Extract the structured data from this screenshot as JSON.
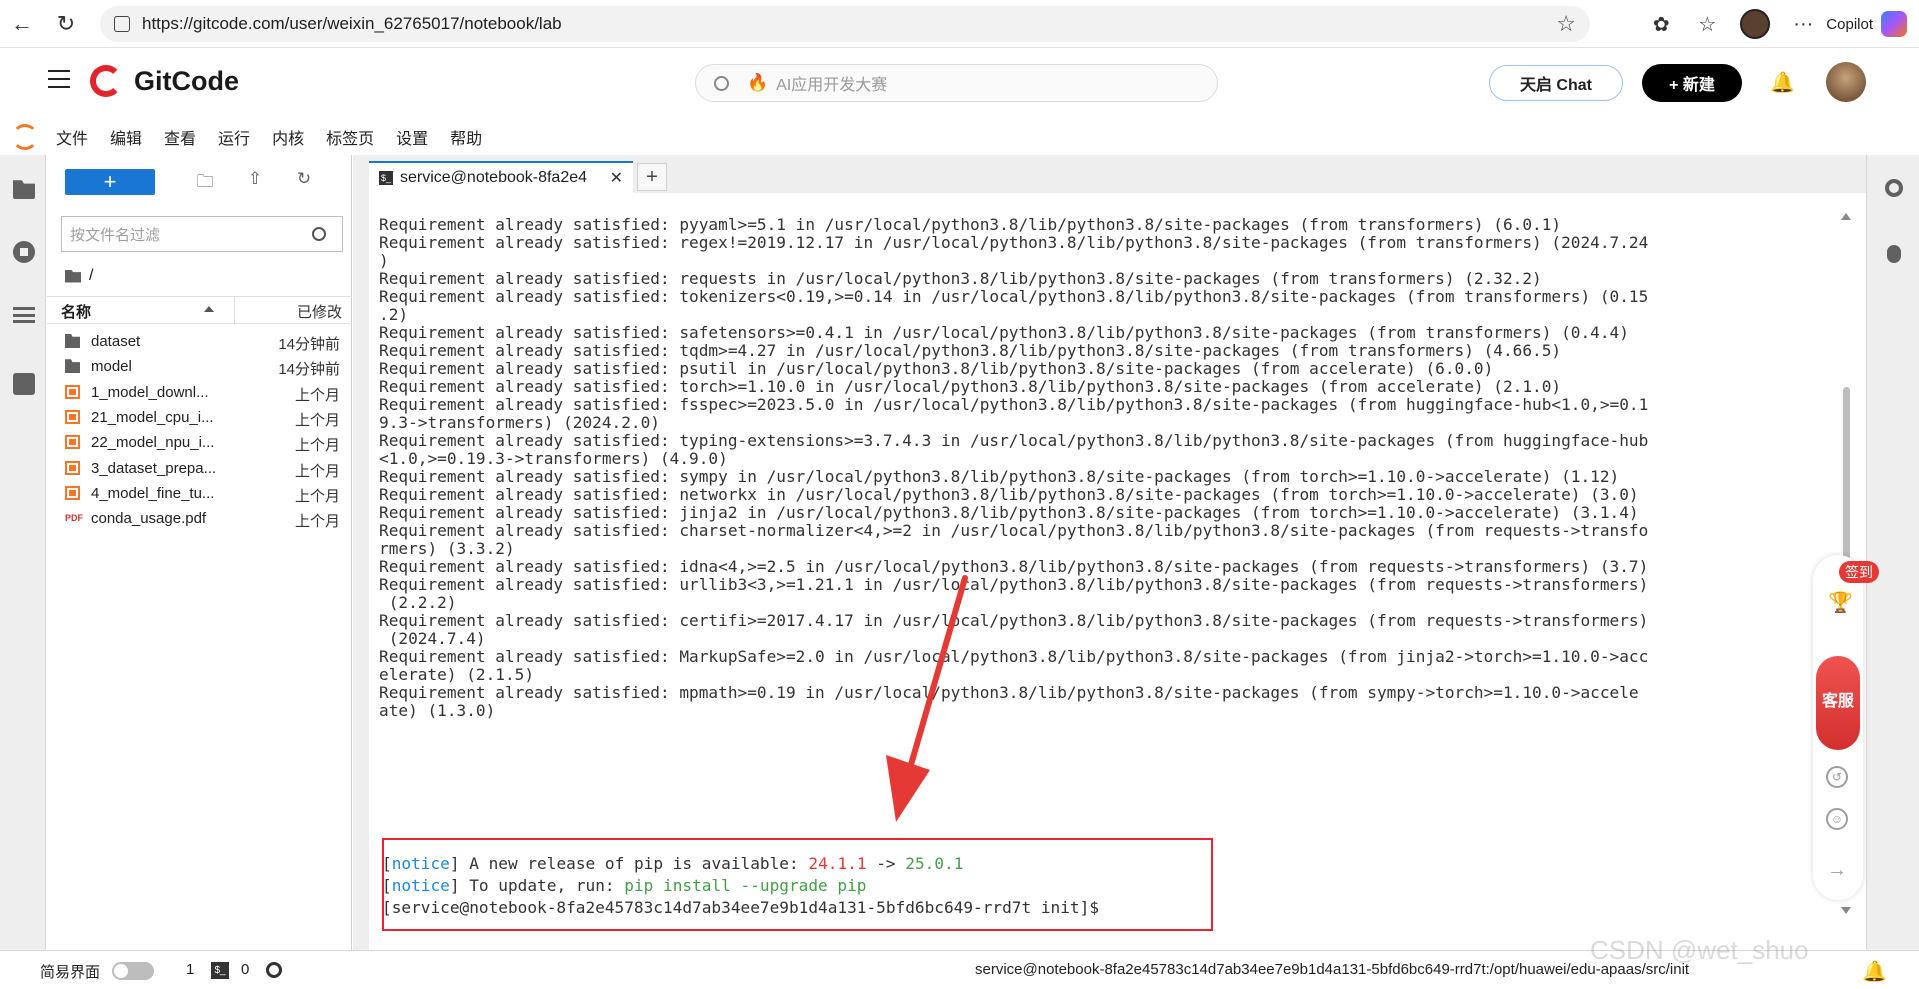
{
  "browser": {
    "url": "https://gitcode.com/user/weixin_62765017/notebook/lab",
    "copilot_label": "Copilot"
  },
  "header": {
    "logo_text": "GitCode",
    "search_placeholder": "AI应用开发大赛",
    "tianqi_chat": "天启 Chat",
    "new_button": "+ 新建"
  },
  "menu": {
    "items": [
      "文件",
      "编辑",
      "查看",
      "运行",
      "内核",
      "标签页",
      "设置",
      "帮助"
    ]
  },
  "file_browser": {
    "new_label": "+",
    "filter_placeholder": "按文件名过滤",
    "breadcrumb": "/",
    "col_name": "名称",
    "col_modified": "已修改",
    "files": [
      {
        "name": "dataset",
        "modified": "14分钟前",
        "type": "folder"
      },
      {
        "name": "model",
        "modified": "14分钟前",
        "type": "folder"
      },
      {
        "name": "1_model_downl...",
        "modified": "上个月",
        "type": "notebook"
      },
      {
        "name": "21_model_cpu_i...",
        "modified": "上个月",
        "type": "notebook"
      },
      {
        "name": "22_model_npu_i...",
        "modified": "上个月",
        "type": "notebook"
      },
      {
        "name": "3_dataset_prepa...",
        "modified": "上个月",
        "type": "notebook"
      },
      {
        "name": "4_model_fine_tu...",
        "modified": "上个月",
        "type": "notebook"
      },
      {
        "name": "conda_usage.pdf",
        "modified": "上个月",
        "type": "pdf"
      }
    ]
  },
  "terminal": {
    "tab_title": "service@notebook-8fa2e4",
    "lines": [
      "Requirement already satisfied: pyyaml>=5.1 in /usr/local/python3.8/lib/python3.8/site-packages (from transformers) (6.0.1)",
      "Requirement already satisfied: regex!=2019.12.17 in /usr/local/python3.8/lib/python3.8/site-packages (from transformers) (2024.7.24",
      ")",
      "Requirement already satisfied: requests in /usr/local/python3.8/lib/python3.8/site-packages (from transformers) (2.32.2)",
      "Requirement already satisfied: tokenizers<0.19,>=0.14 in /usr/local/python3.8/lib/python3.8/site-packages (from transformers) (0.15",
      ".2)",
      "Requirement already satisfied: safetensors>=0.4.1 in /usr/local/python3.8/lib/python3.8/site-packages (from transformers) (0.4.4)",
      "Requirement already satisfied: tqdm>=4.27 in /usr/local/python3.8/lib/python3.8/site-packages (from transformers) (4.66.5)",
      "Requirement already satisfied: psutil in /usr/local/python3.8/lib/python3.8/site-packages (from accelerate) (6.0.0)",
      "Requirement already satisfied: torch>=1.10.0 in /usr/local/python3.8/lib/python3.8/site-packages (from accelerate) (2.1.0)",
      "Requirement already satisfied: fsspec>=2023.5.0 in /usr/local/python3.8/lib/python3.8/site-packages (from huggingface-hub<1.0,>=0.1",
      "9.3->transformers) (2024.2.0)",
      "Requirement already satisfied: typing-extensions>=3.7.4.3 in /usr/local/python3.8/lib/python3.8/site-packages (from huggingface-hub",
      "<1.0,>=0.19.3->transformers) (4.9.0)",
      "Requirement already satisfied: sympy in /usr/local/python3.8/lib/python3.8/site-packages (from torch>=1.10.0->accelerate) (1.12)",
      "Requirement already satisfied: networkx in /usr/local/python3.8/lib/python3.8/site-packages (from torch>=1.10.0->accelerate) (3.0)",
      "Requirement already satisfied: jinja2 in /usr/local/python3.8/lib/python3.8/site-packages (from torch>=1.10.0->accelerate) (3.1.4)",
      "Requirement already satisfied: charset-normalizer<4,>=2 in /usr/local/python3.8/lib/python3.8/site-packages (from requests->transfo",
      "rmers) (3.3.2)",
      "Requirement already satisfied: idna<4,>=2.5 in /usr/local/python3.8/lib/python3.8/site-packages (from requests->transformers) (3.7)",
      "Requirement already satisfied: urllib3<3,>=1.21.1 in /usr/local/python3.8/lib/python3.8/site-packages (from requests->transformers)",
      " (2.2.2)",
      "Requirement already satisfied: certifi>=2017.4.17 in /usr/local/python3.8/lib/python3.8/site-packages (from requests->transformers)",
      " (2024.7.4)",
      "Requirement already satisfied: MarkupSafe>=2.0 in /usr/local/python3.8/lib/python3.8/site-packages (from jinja2->torch>=1.10.0->acc",
      "elerate) (2.1.5)",
      "Requirement already satisfied: mpmath>=0.19 in /usr/local/python3.8/lib/python3.8/site-packages (from sympy->torch>=1.10.0->accele",
      "ate) (1.3.0)"
    ],
    "notice_tag": "notice",
    "notice1_text": " A new release of pip is available: ",
    "old_version": "24.1.1",
    "arrow": " -> ",
    "new_version": "25.0.1",
    "notice2_text": " To update, run: ",
    "update_cmd": "pip install --upgrade pip",
    "prompt": "[service@notebook-8fa2e45783c14d7ab34ee7e9b1d4a131-5bfd6bc649-rrd7t init]$"
  },
  "side_float": {
    "sign_in": "签到",
    "kefu": "客服"
  },
  "status_bar": {
    "simple_mode": "简易界面",
    "count1": "1",
    "count2": "0",
    "path": "service@notebook-8fa2e45783c14d7ab34ee7e9b1d4a131-5bfd6bc649-rrd7t:/opt/huawei/edu-apaas/src/init",
    "watermark": "CSDN @wet_shuo"
  },
  "colors": {
    "accent": "#1976d2",
    "highlight_box": "#e8242c",
    "arrow": "#e53935",
    "notice_blue": "#1e88e5",
    "version_red": "#e53935",
    "version_green": "#43a047"
  }
}
